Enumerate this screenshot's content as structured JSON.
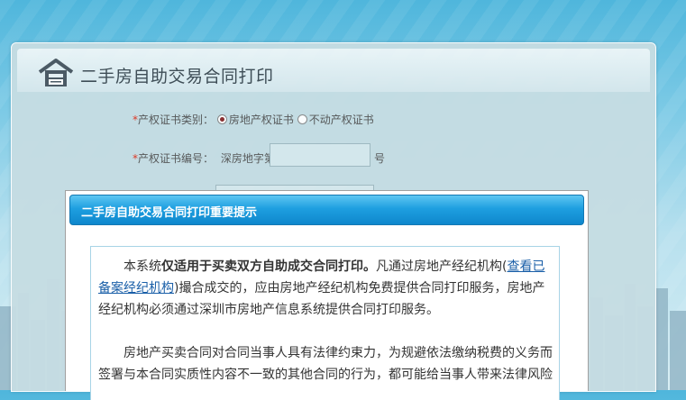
{
  "page": {
    "title": "二手房自助交易合同打印"
  },
  "form": {
    "cert_type_label": "产权证书类别：",
    "cert_type_required": "*",
    "cert_type_options": [
      "房地产权证书",
      "不动产权证书"
    ],
    "cert_type_selected": "房地产权证书",
    "cert_no_label": "产权证书编号：",
    "cert_no_required": "*",
    "cert_no_prefix": "深房地字第",
    "cert_no_value": "",
    "cert_no_suffix": "号"
  },
  "modal": {
    "title": "二手房自助交易合同打印重要提示",
    "p1_lead": "本系统",
    "p1_bold": "仅适用于买卖双方自助成交合同打印。",
    "p1_mid": "凡通过房地产经纪机构(",
    "p1_link": "查看已备案经纪机构",
    "p1_tail": ")撮合成交的，应由房地产经纪机构免费提供合同打印服务，房地产经纪机构必须通过深圳市房地产信息系统提供合同打印服务。",
    "p2": "房地产买卖合同对合同当事人具有法律约束力，为规避依法缴纳税费的义务而签署与本合同实质性内容不一致的其他合同的行为，都可能给当事人带来法律风险"
  },
  "colors": {
    "accent": "#1e9fe0",
    "required": "#e0341f",
    "link": "#1a5fa8"
  }
}
